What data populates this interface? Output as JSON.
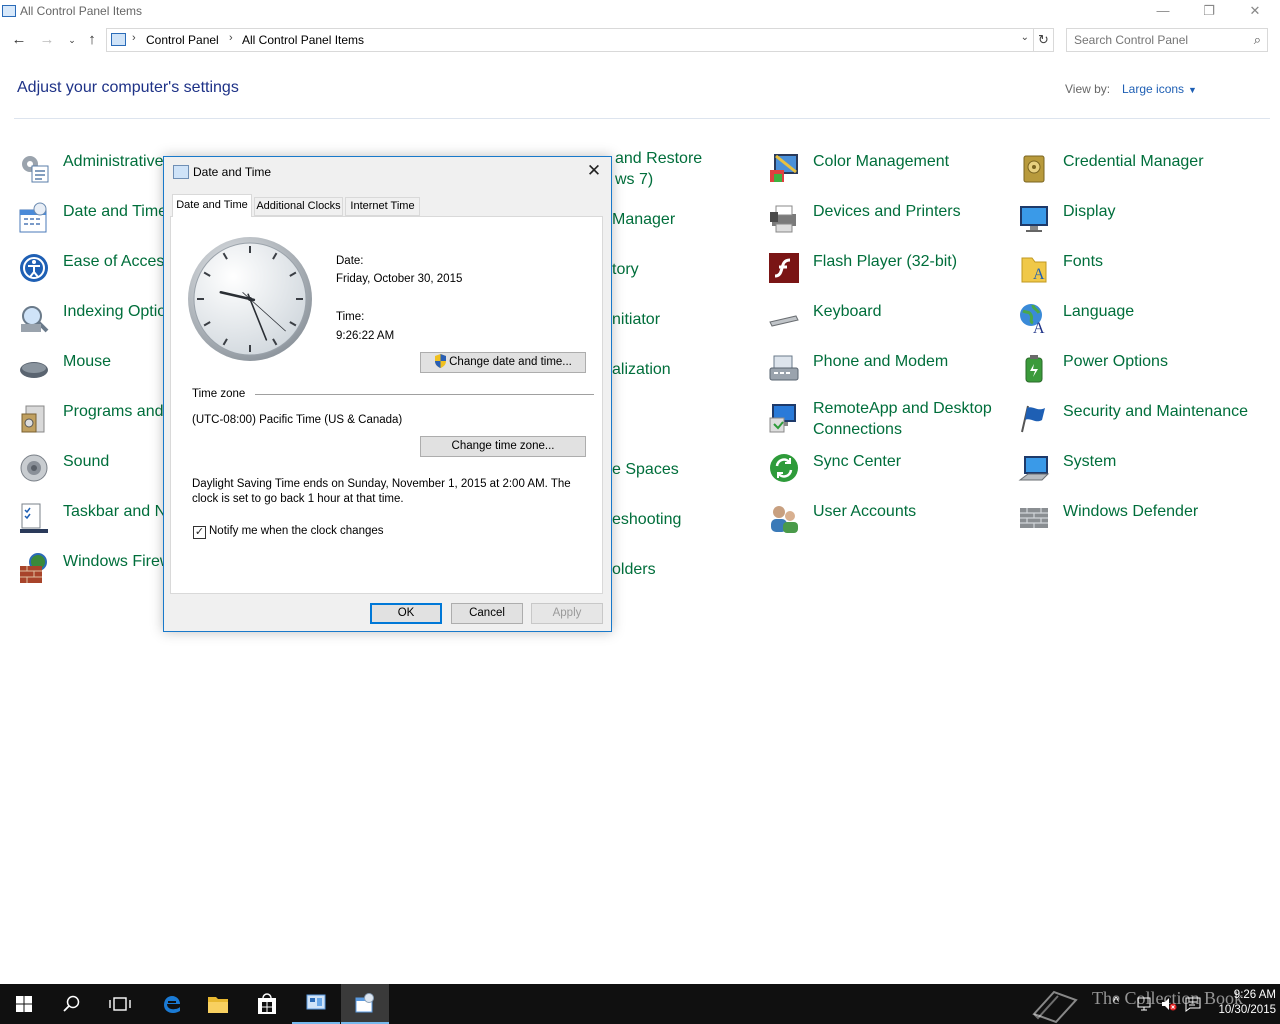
{
  "window": {
    "title": "All Control Panel Items",
    "minimize_glyph": "—",
    "restore_glyph": "❐",
    "close_glyph": "✕"
  },
  "address": {
    "crumbs": [
      "Control Panel",
      "All Control Panel Items"
    ],
    "search_placeholder": "Search Control Panel"
  },
  "header": {
    "title": "Adjust your computer's settings",
    "view_by_label": "View by:",
    "view_by_value": "Large icons"
  },
  "items": [
    {
      "label": "Administrative",
      "icon": "administrative-tools-icon"
    },
    {
      "label": "Date and Time",
      "icon": "date-time-icon"
    },
    {
      "label": "Ease of Access",
      "icon": "ease-of-access-icon"
    },
    {
      "label": "Indexing Optio",
      "icon": "indexing-options-icon"
    },
    {
      "label": "Mouse",
      "icon": "mouse-icon"
    },
    {
      "label": "Programs and",
      "icon": "programs-features-icon"
    },
    {
      "label": "Sound",
      "icon": "sound-icon"
    },
    {
      "label": "Taskbar and Na",
      "icon": "taskbar-navigation-icon"
    },
    {
      "label": "Windows Firew",
      "icon": "windows-firewall-icon"
    }
  ],
  "items_col2": [
    {
      "label1": "and Restore",
      "label2": "ws 7)"
    },
    {
      "label1": "Manager"
    },
    {
      "label1": "tory"
    },
    {
      "label1": "nitiator"
    },
    {
      "label1": "alization"
    },
    {
      "label1": "e Spaces"
    },
    {
      "label1": "eshooting"
    },
    {
      "label1": "olders"
    }
  ],
  "items_col3": [
    {
      "label": "Color Management",
      "icon": "color-management-icon",
      "color": "#4a90d9"
    },
    {
      "label": "Devices and Printers",
      "icon": "printer-icon",
      "color": "#6a6a6a"
    },
    {
      "label": "Flash Player (32-bit)",
      "icon": "flash-player-icon",
      "color": "#8b1a1a"
    },
    {
      "label": "Keyboard",
      "icon": "keyboard-icon",
      "color": "#8a8a8a"
    },
    {
      "label": "Phone and Modem",
      "icon": "phone-modem-icon",
      "color": "#7a7a7a"
    },
    {
      "label": "RemoteApp and Desktop",
      "label2": "Connections",
      "icon": "remoteapp-icon",
      "color": "#2a6bb8"
    },
    {
      "label": "Sync Center",
      "icon": "sync-center-icon",
      "color": "#2e9b3a"
    },
    {
      "label": "User Accounts",
      "icon": "user-accounts-icon",
      "color": "#5a7a9a"
    }
  ],
  "items_col4": [
    {
      "label": "Credential Manager",
      "icon": "credential-manager-icon",
      "color": "#b89a3c"
    },
    {
      "label": "Display",
      "icon": "display-icon",
      "color": "#2a8fd8"
    },
    {
      "label": "Fonts",
      "icon": "fonts-icon",
      "color": "#e5b93a"
    },
    {
      "label": "Language",
      "icon": "language-icon",
      "color": "#2a7ab8"
    },
    {
      "label": "Power Options",
      "icon": "power-options-icon",
      "color": "#3a9a3a"
    },
    {
      "label": "Security and Maintenance",
      "icon": "security-flag-icon",
      "color": "#1e5fb4"
    },
    {
      "label": "System",
      "icon": "system-icon",
      "color": "#3a8fd8"
    },
    {
      "label": "Windows Defender",
      "icon": "windows-defender-icon",
      "color": "#8a8a8a"
    }
  ],
  "dialog": {
    "title": "Date and Time",
    "tabs": [
      "Date and Time",
      "Additional Clocks",
      "Internet Time"
    ],
    "date_label": "Date:",
    "date_value": "Friday, October 30, 2015",
    "time_label": "Time:",
    "time_value": "9:26:22 AM",
    "change_datetime_button": "Change date and time...",
    "timezone_header": "Time zone",
    "timezone_value": "(UTC-08:00) Pacific Time (US & Canada)",
    "change_timezone_button": "Change time zone...",
    "dst_line1": "Daylight Saving Time ends on Sunday, November 1, 2015 at 2:00 AM. The",
    "dst_line2": "clock is set to go back 1 hour at that time.",
    "notify_checkbox_label": "Notify me when the clock changes",
    "notify_checked": true,
    "ok_button": "OK",
    "cancel_button": "Cancel",
    "apply_button": "Apply"
  },
  "clock_hands": {
    "hour": 9,
    "minute": 26,
    "second": 22
  },
  "taskbar": {
    "buttons": [
      "start-button",
      "search-button",
      "task-view-button",
      "edge-button",
      "file-explorer-button",
      "store-button",
      "control-panel-button",
      "date-time-button"
    ],
    "clock_time": "9:26 AM",
    "clock_date": "10/30/2015",
    "watermark": "The Collection Book"
  }
}
